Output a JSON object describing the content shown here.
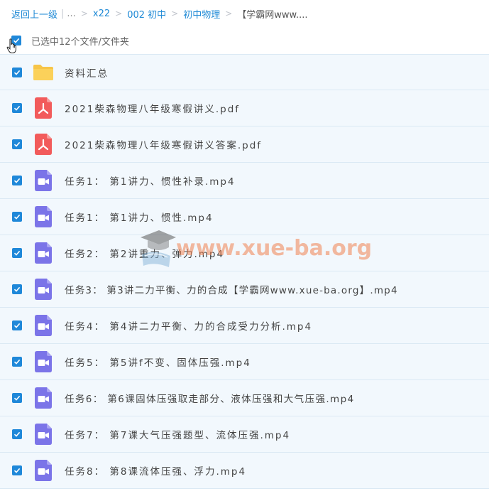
{
  "breadcrumb": {
    "back": "返回上一级",
    "ellipsis": "...",
    "items": [
      "x22",
      "002 初中",
      "初中物理"
    ],
    "current": "【学霸网www...."
  },
  "selection": {
    "text": "已选中12个文件/文件夹"
  },
  "files": [
    {
      "name": "资料汇总",
      "icon": "folder-icon"
    },
    {
      "name": "2021柴森物理八年级寒假讲义.pdf",
      "icon": "pdf-icon"
    },
    {
      "name": "2021柴森物理八年级寒假讲义答案.pdf",
      "icon": "pdf-icon"
    },
    {
      "name": "任务1： 第1讲力、惯性补录.mp4",
      "icon": "video-icon"
    },
    {
      "name": "任务1： 第1讲力、惯性.mp4",
      "icon": "video-icon"
    },
    {
      "name": "任务2： 第2讲重力、弹力.mp4",
      "icon": "video-icon"
    },
    {
      "name": "任务3： 第3讲二力平衡、力的合成【学霸网www.xue-ba.org】.mp4",
      "icon": "video-icon"
    },
    {
      "name": "任务4： 第4讲二力平衡、力的合成受力分析.mp4",
      "icon": "video-icon"
    },
    {
      "name": "任务5： 第5讲f不变、固体压强.mp4",
      "icon": "video-icon"
    },
    {
      "name": "任务6： 第6课固体压强取走部分、液体压强和大气压强.mp4",
      "icon": "video-icon"
    },
    {
      "name": "任务7： 第7课大气压强题型、流体压强.mp4",
      "icon": "video-icon"
    },
    {
      "name": "任务8： 第8课流体压强、浮力.mp4",
      "icon": "video-icon"
    }
  ],
  "watermark": {
    "text": "www.xue-ba.org"
  },
  "colors": {
    "link": "#1f8ad6",
    "checkbox": "#1f88d9",
    "row_bg": "#f2f8fd",
    "folder": "#f9c94a",
    "pdf": "#f25b5b",
    "video": "#7b74e8",
    "watermark": "#f0824f"
  }
}
